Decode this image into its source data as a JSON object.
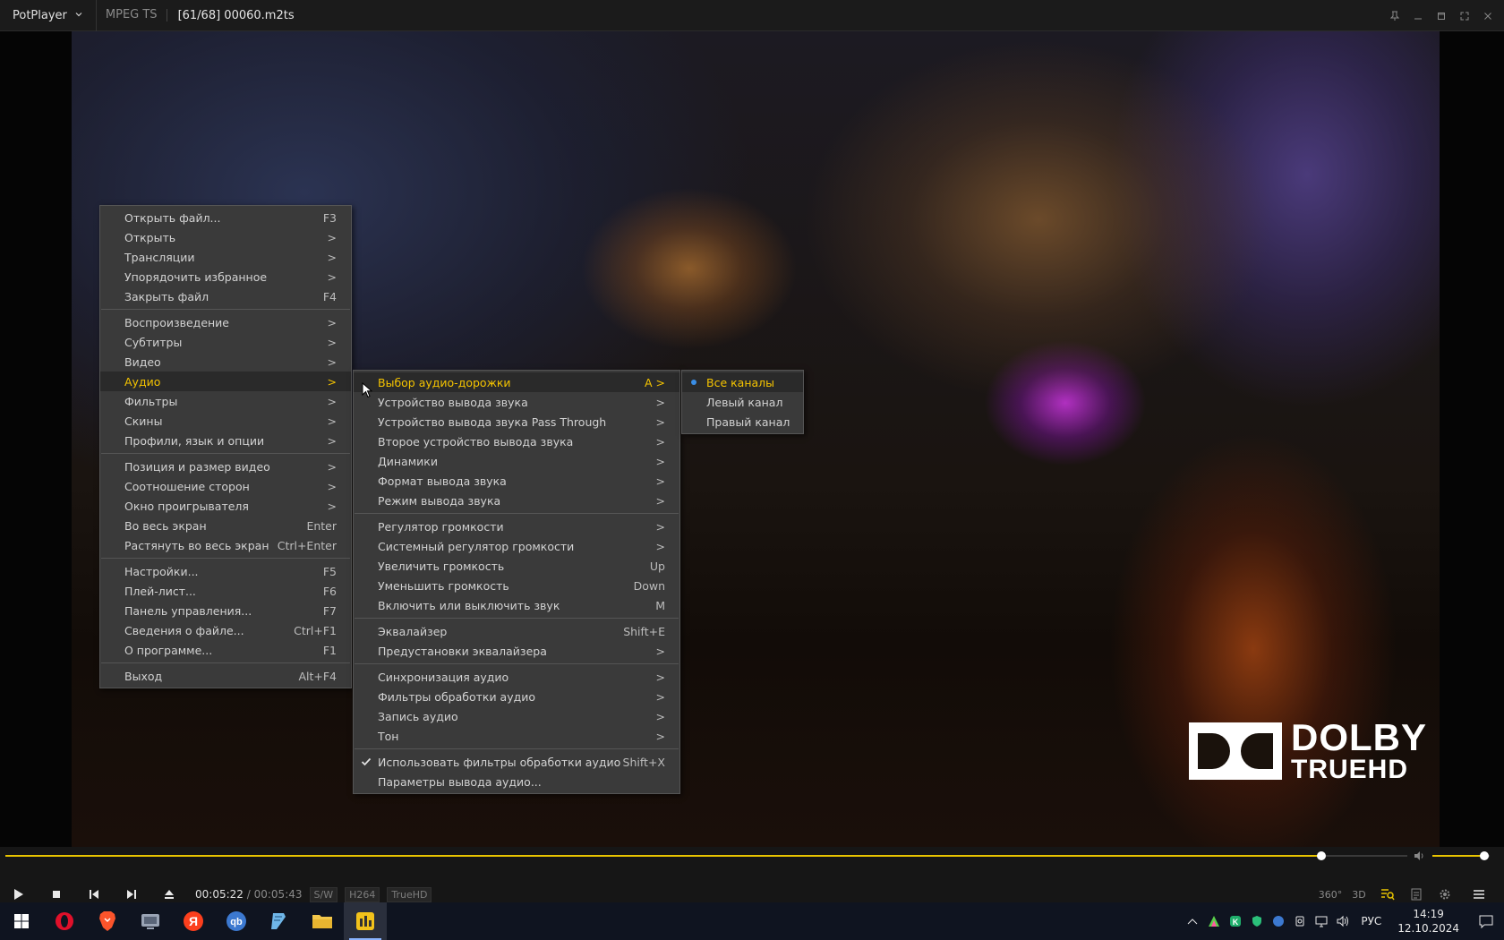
{
  "titlebar": {
    "app_name": "PotPlayer",
    "format": "MPEG TS",
    "file": "[61/68] 00060.m2ts"
  },
  "overlay": {
    "logo_line1": "DOLBY",
    "logo_line2": "TRUEHD"
  },
  "main_menu": {
    "items": [
      {
        "label": "Открыть файл...",
        "shortcut": "F3"
      },
      {
        "label": "Открыть",
        "shortcut": ">"
      },
      {
        "label": "Трансляции",
        "shortcut": ">"
      },
      {
        "label": "Упорядочить избранное",
        "shortcut": ">"
      },
      {
        "label": "Закрыть файл",
        "shortcut": "F4"
      },
      {
        "label": "Воспроизведение",
        "shortcut": ">"
      },
      {
        "label": "Субтитры",
        "shortcut": ">"
      },
      {
        "label": "Видео",
        "shortcut": ">"
      },
      {
        "label": "Аудио",
        "shortcut": ">"
      },
      {
        "label": "Фильтры",
        "shortcut": ">"
      },
      {
        "label": "Скины",
        "shortcut": ">"
      },
      {
        "label": "Профили, язык и опции",
        "shortcut": ">"
      },
      {
        "label": "Позиция и размер видео",
        "shortcut": ">"
      },
      {
        "label": "Соотношение сторон",
        "shortcut": ">"
      },
      {
        "label": "Окно проигрывателя",
        "shortcut": ">"
      },
      {
        "label": "Во весь экран",
        "shortcut": "Enter"
      },
      {
        "label": "Растянуть во весь экран",
        "shortcut": "Ctrl+Enter"
      },
      {
        "label": "Настройки...",
        "shortcut": "F5"
      },
      {
        "label": "Плей-лист...",
        "shortcut": "F6"
      },
      {
        "label": "Панель управления...",
        "shortcut": "F7"
      },
      {
        "label": "Сведения о файле...",
        "shortcut": "Ctrl+F1"
      },
      {
        "label": "О программе...",
        "shortcut": "F1"
      },
      {
        "label": "Выход",
        "shortcut": "Alt+F4"
      }
    ]
  },
  "audio_menu": {
    "items": [
      {
        "label": "Выбор аудио-дорожки",
        "shortcut": "A >"
      },
      {
        "label": "Устройство вывода звука",
        "shortcut": ">"
      },
      {
        "label": "Устройство вывода звука Pass Through",
        "shortcut": ">"
      },
      {
        "label": "Второе устройство вывода звука",
        "shortcut": ">"
      },
      {
        "label": "Динамики",
        "shortcut": ">"
      },
      {
        "label": "Формат вывода звука",
        "shortcut": ">"
      },
      {
        "label": "Режим вывода звука",
        "shortcut": ">"
      },
      {
        "label": "Регулятор громкости",
        "shortcut": ">"
      },
      {
        "label": "Системный регулятор громкости",
        "shortcut": ">"
      },
      {
        "label": "Увеличить громкость",
        "shortcut": "Up"
      },
      {
        "label": "Уменьшить громкость",
        "shortcut": "Down"
      },
      {
        "label": "Включить или выключить звук",
        "shortcut": "M"
      },
      {
        "label": "Эквалайзер",
        "shortcut": "Shift+E"
      },
      {
        "label": "Предустановки эквалайзера",
        "shortcut": ">"
      },
      {
        "label": "Синхронизация аудио",
        "shortcut": ">"
      },
      {
        "label": "Фильтры обработки аудио",
        "shortcut": ">"
      },
      {
        "label": "Запись аудио",
        "shortcut": ">"
      },
      {
        "label": "Тон",
        "shortcut": ">"
      },
      {
        "label": "Использовать фильтры обработки аудио",
        "shortcut": "Shift+X"
      },
      {
        "label": "Параметры вывода аудио...",
        "shortcut": ""
      }
    ]
  },
  "channel_menu": {
    "items": [
      {
        "label": "Все каналы"
      },
      {
        "label": "Левый канал"
      },
      {
        "label": "Правый канал"
      }
    ]
  },
  "player": {
    "current_time": "00:05:22",
    "separator": "/",
    "total_time": "00:05:43",
    "tag_sw": "S/W",
    "tag_codec": "H264",
    "tag_audio": "TrueHD",
    "btn_360": "360°",
    "btn_3d": "3D",
    "progress_fraction": 0.939,
    "volume_fraction": 0.9
  },
  "taskbar": {
    "lang": "РУС",
    "time": "14:19",
    "date": "12.10.2024"
  },
  "colors": {
    "accent": "#f5c400",
    "menu_bg": "#3a3a3a",
    "radio_dot": "#3a8ee6"
  }
}
